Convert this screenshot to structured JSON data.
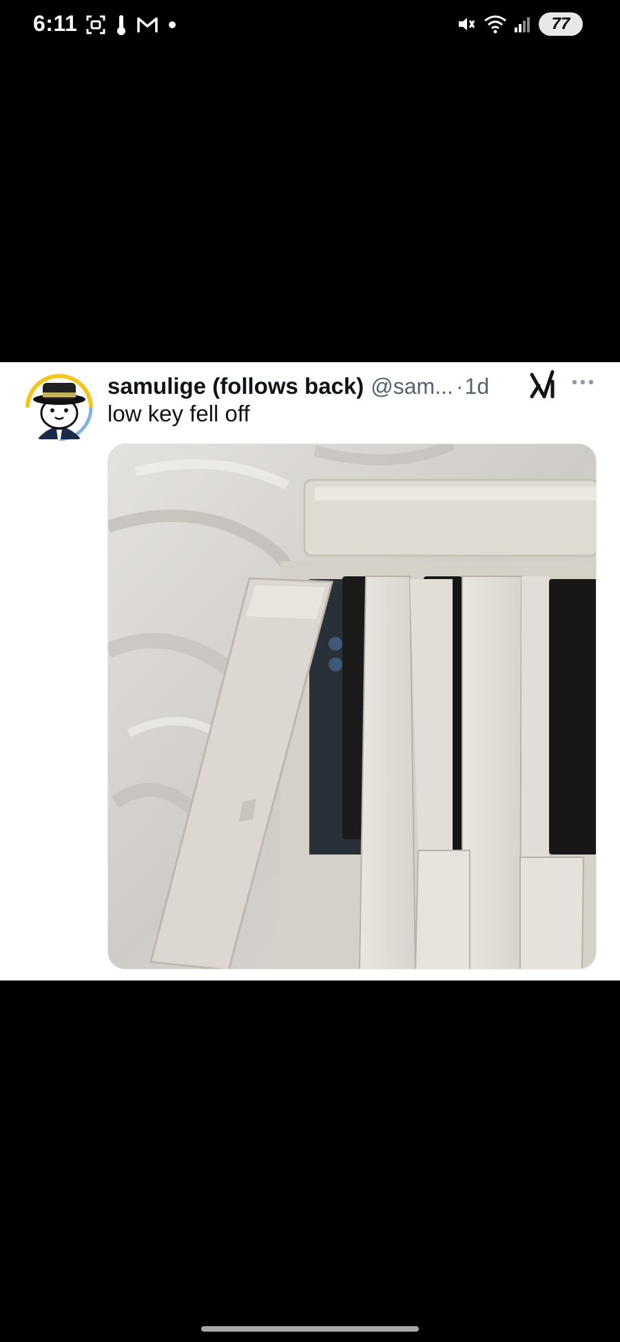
{
  "status_bar": {
    "time": "6:11",
    "left_icons": [
      "screenshot-icon",
      "thermometer-icon",
      "gmail-icon",
      "notification-dot-icon"
    ],
    "right_icons": [
      "vibrate-mute-icon",
      "wifi-icon",
      "signal-icon"
    ],
    "battery": "77"
  },
  "tweet": {
    "display_name": "samulige (follows back)",
    "handle": "@sam...",
    "separator": "·",
    "timestamp": "1d",
    "text": "low key fell off",
    "media_icon": "grok-icon",
    "more_icon": "more-options-icon"
  },
  "colors": {
    "background": "#000000",
    "card": "#ffffff",
    "primary_text": "#0f1419",
    "secondary_text": "#536471"
  }
}
